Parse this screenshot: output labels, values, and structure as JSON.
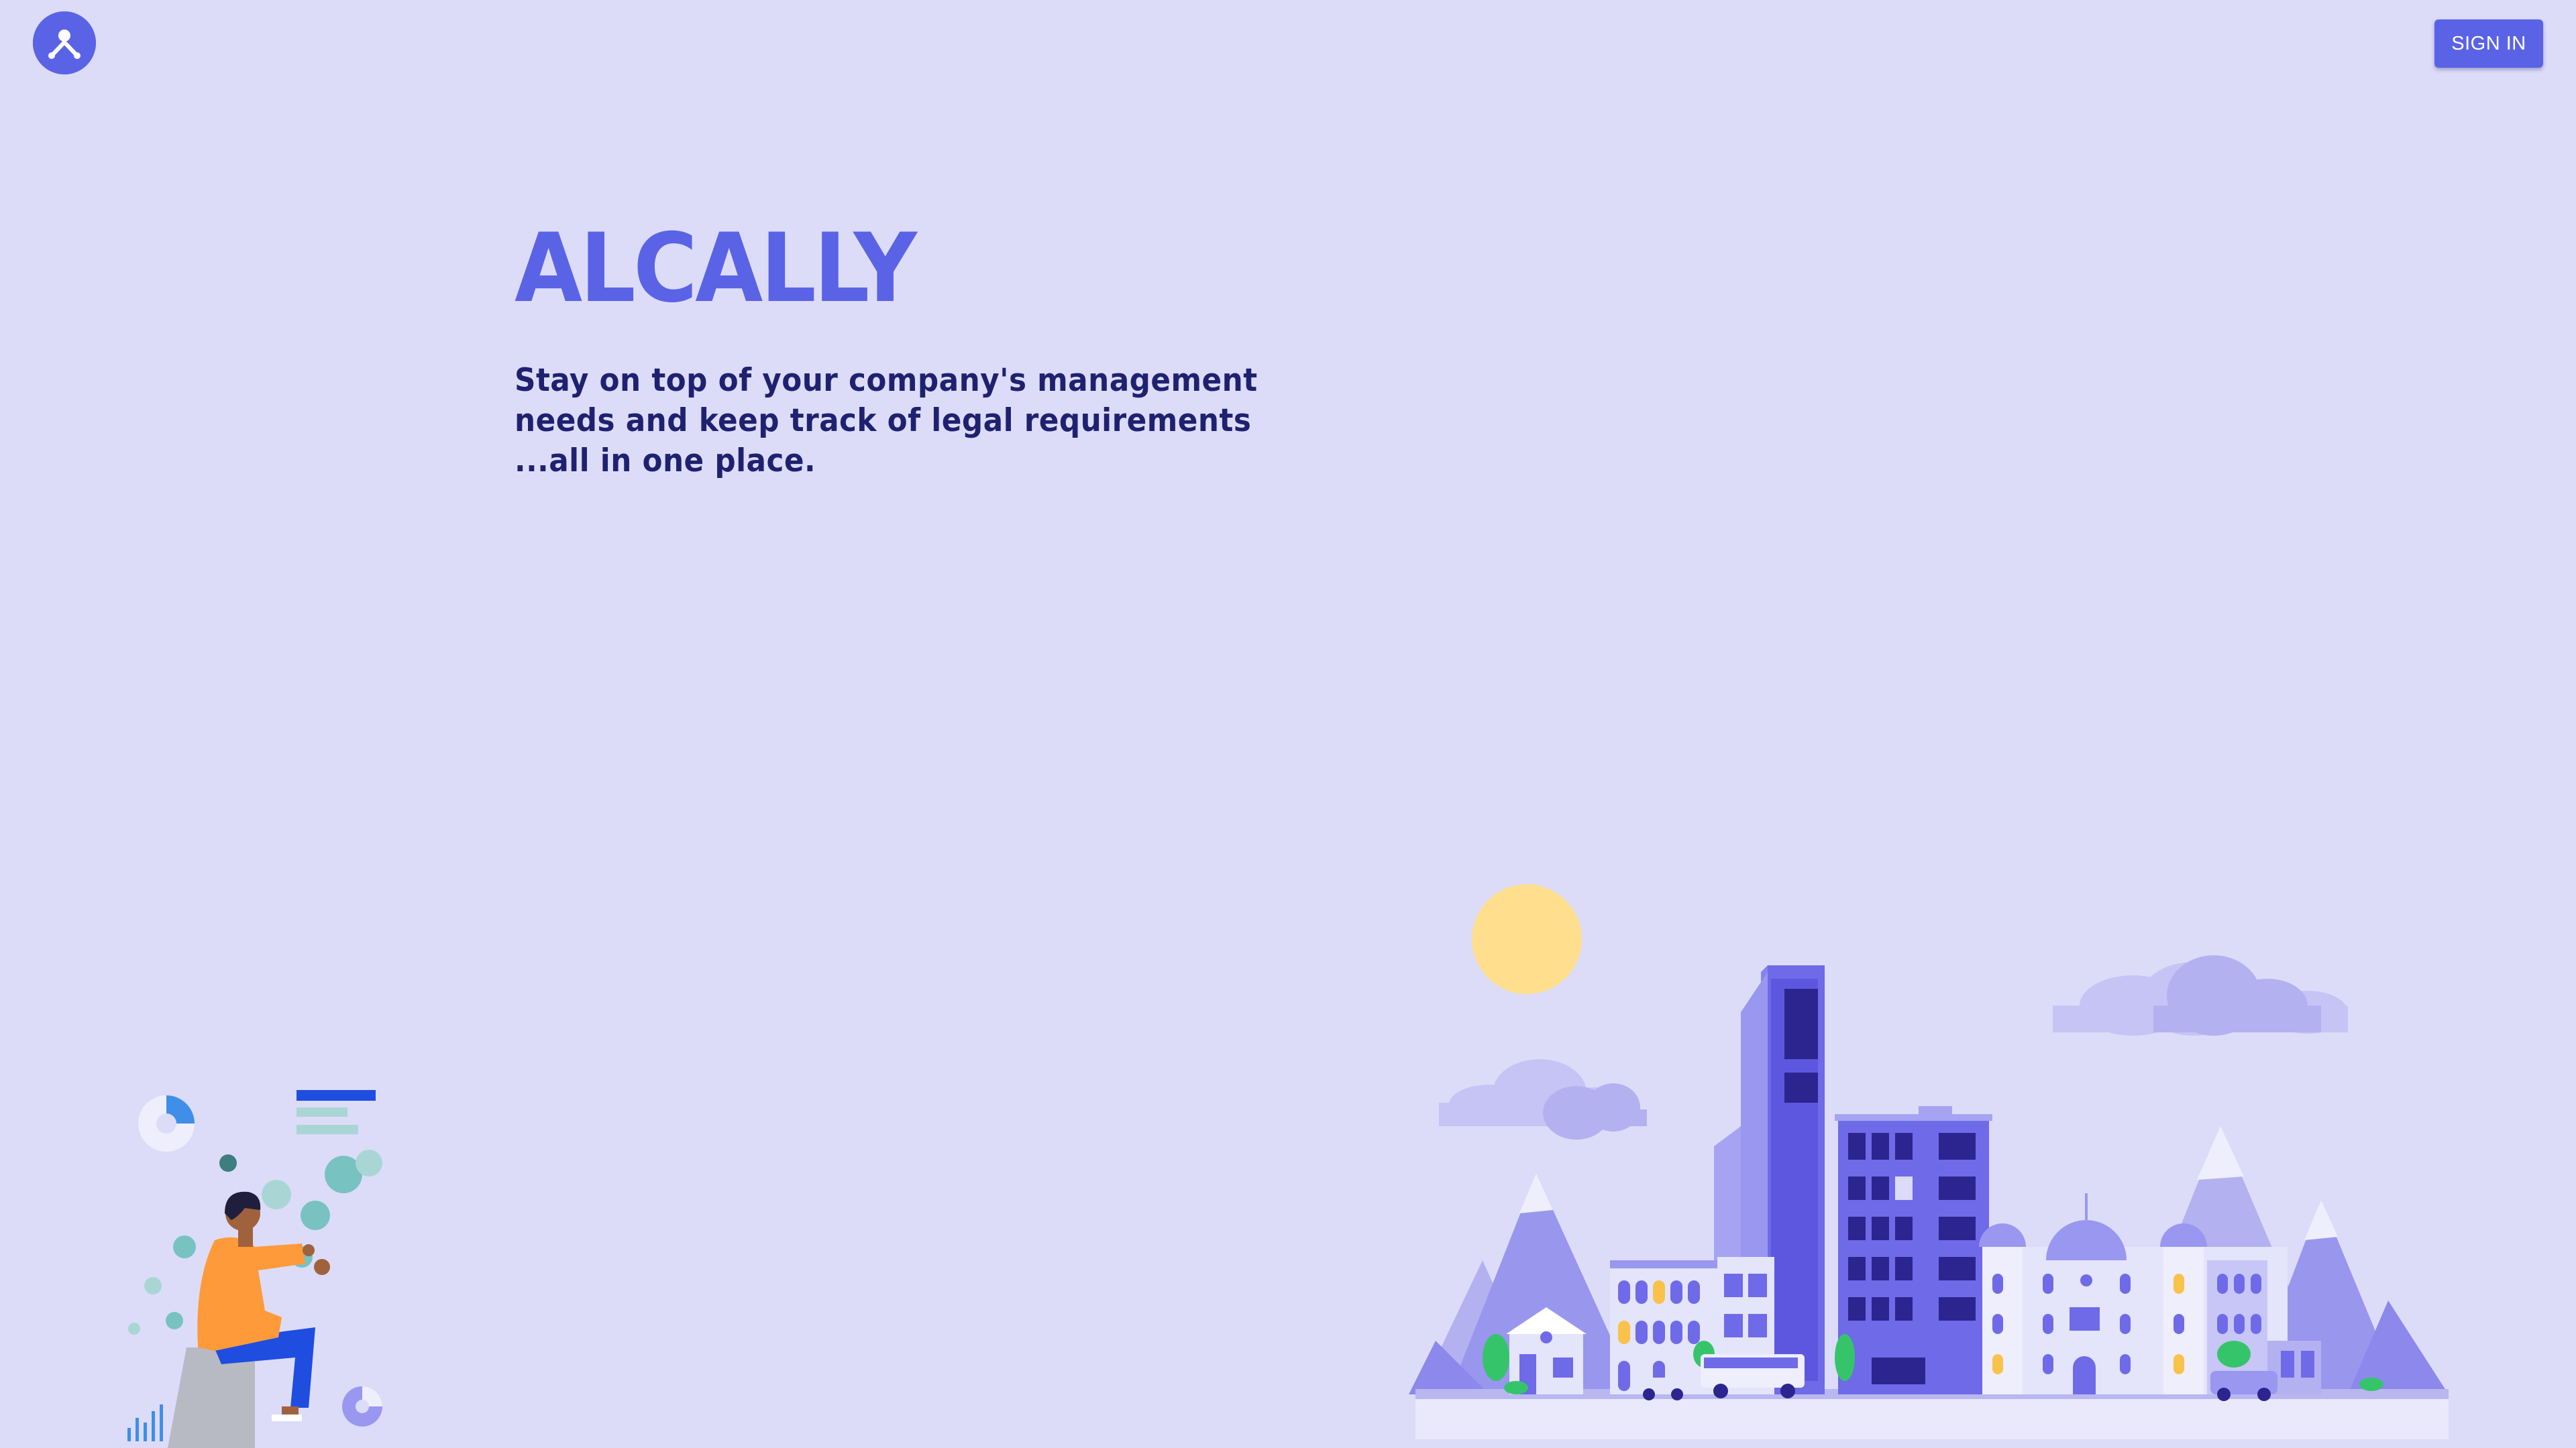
{
  "header": {
    "signin_label": "SIGN IN"
  },
  "hero": {
    "brand": "ALCALLY",
    "tagline_lines": [
      "Stay on top of your company's management",
      "needs and keep track of legal requirements",
      "...all in one place."
    ]
  },
  "colors": {
    "background": "#dcdcf9",
    "accent": "#5a63e6",
    "heading_text": "#1f2170"
  },
  "icons": {
    "logo": "alcally-logo-icon"
  }
}
